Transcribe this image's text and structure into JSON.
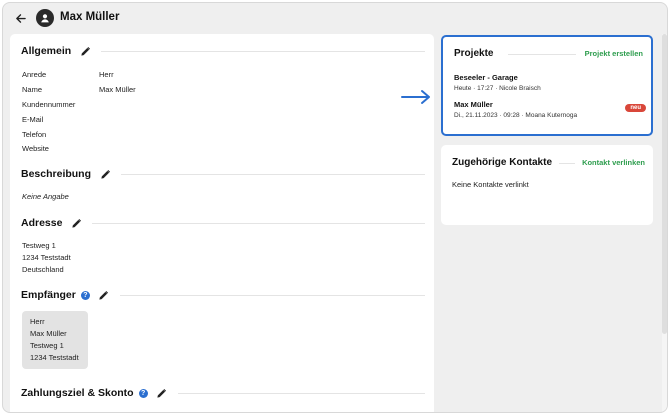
{
  "header": {
    "title": "Max Müller",
    "back_icon": "arrow-left-icon",
    "avatar_icon": "user-avatar-icon"
  },
  "general": {
    "heading": "Allgemein",
    "fields": [
      {
        "label": "Anrede",
        "value": "Herr"
      },
      {
        "label": "Name",
        "value": "Max Müller"
      },
      {
        "label": "Kundennummer",
        "value": ""
      },
      {
        "label": "E-Mail",
        "value": ""
      },
      {
        "label": "Telefon",
        "value": ""
      },
      {
        "label": "Website",
        "value": ""
      }
    ]
  },
  "description": {
    "heading": "Beschreibung",
    "text": "Keine Angabe"
  },
  "address": {
    "heading": "Adresse",
    "lines": [
      "Testweg 1",
      "1234 Teststadt",
      "Deutschland"
    ]
  },
  "recipient": {
    "heading": "Empfänger",
    "help_icon": "?",
    "lines": [
      "Herr",
      "Max Müller",
      "Testweg 1",
      "1234 Teststadt"
    ]
  },
  "payment": {
    "heading": "Zahlungsziel & Skonto",
    "help_icon": "?"
  },
  "projects": {
    "title": "Projekte",
    "action": "Projekt erstellen",
    "items": [
      {
        "name": "Beseeler - Garage",
        "meta": "Heute · 17:27 · Nicole Braisch",
        "badge": ""
      },
      {
        "name": "Max Müller",
        "meta": "Di., 21.11.2023 · 09:28 · Moana Kuternoga",
        "badge": "neu"
      }
    ]
  },
  "contacts": {
    "title": "Zugehörige Kontakte",
    "action": "Kontakt verlinken",
    "empty": "Keine Kontakte verlinkt"
  },
  "colors": {
    "accent_blue": "#2b6fd0",
    "link_green": "#2e9d4e",
    "badge_red": "#d9473a",
    "background": "#efefef"
  }
}
